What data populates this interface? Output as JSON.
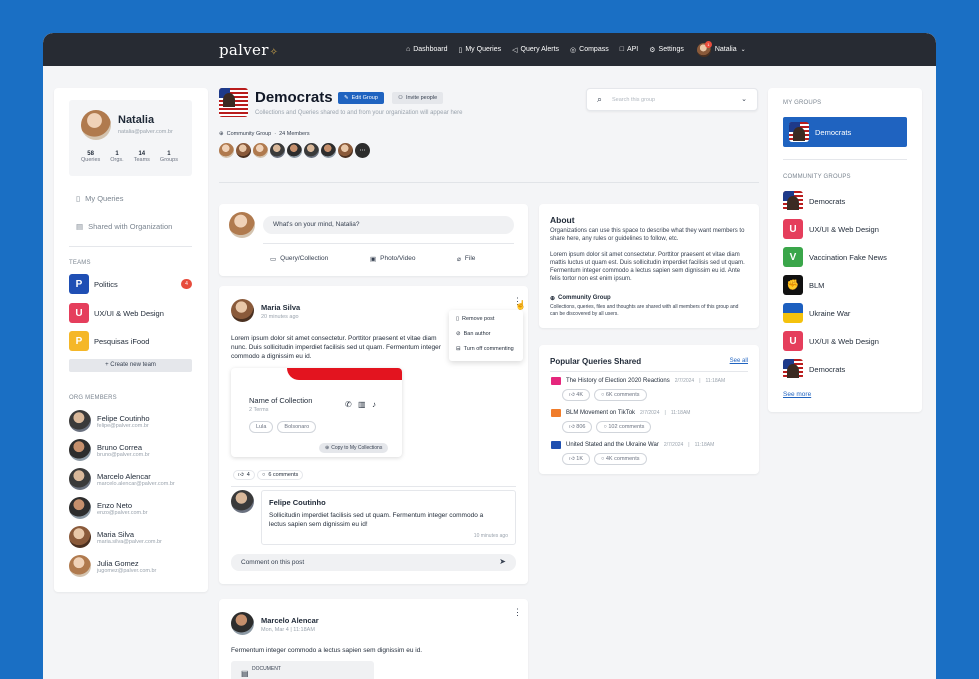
{
  "app": {
    "logo": "palver"
  },
  "nav": {
    "items": [
      {
        "label": "Dashboard",
        "icon": "home-icon"
      },
      {
        "label": "My Queries",
        "icon": "bookmark-icon"
      },
      {
        "label": "Query Alerts",
        "icon": "megaphone-icon"
      },
      {
        "label": "Compass",
        "icon": "compass-icon"
      },
      {
        "label": "API",
        "icon": "api-icon"
      },
      {
        "label": "Settings",
        "icon": "gear-icon"
      }
    ],
    "user": "Natalia",
    "user_badge": "1"
  },
  "profile": {
    "name": "Natalia",
    "email": "natalia@palver.com.br",
    "stats": [
      {
        "value": "58",
        "label": "Queries"
      },
      {
        "value": "1",
        "label": "Orgs."
      },
      {
        "value": "14",
        "label": "Teams"
      },
      {
        "value": "1",
        "label": "Groups"
      }
    ]
  },
  "sidebar": {
    "my_queries": "My Queries",
    "shared": "Shared with Organization",
    "teams_title": "TEAMS",
    "teams": [
      {
        "letter": "P",
        "name": "Politics",
        "color": "#1f4fb4",
        "count": "4"
      },
      {
        "letter": "U",
        "name": "UX/UI & Web Design",
        "color": "#e53e5c",
        "count": ""
      },
      {
        "letter": "P",
        "name": "Pesquisas iFood",
        "color": "#f5b728",
        "count": ""
      }
    ],
    "create_team": "+ Create new team",
    "members_title": "ORG MEMBERS",
    "members": [
      {
        "name": "Felipe Coutinho",
        "email": "felipe@palver.com.br"
      },
      {
        "name": "Bruno Correa",
        "email": "bruno@palver.com.br"
      },
      {
        "name": "Marcelo Alencar",
        "email": "marcelo.alencar@palver.com.br"
      },
      {
        "name": "Enzo Neto",
        "email": "enzo@palver.com.br"
      },
      {
        "name": "Maria Silva",
        "email": "maria.silva@palver.com.br"
      },
      {
        "name": "Julia Gomez",
        "email": "jugomez@palver.com.br"
      }
    ]
  },
  "group": {
    "title": "Democrats",
    "edit": "Edit Group",
    "invite": "Invite people",
    "subtitle": "Collections and Queries shared to and from your organization will appear here",
    "type": "Community Group",
    "members": "24 Members",
    "search_placeholder": "Search this group"
  },
  "composer": {
    "placeholder": "What's on your mind, Natalia?",
    "actions": [
      "Query/Collection",
      "Photo/Video",
      "File"
    ]
  },
  "post1": {
    "author": "Maria Silva",
    "time": "20 minutes ago",
    "body": "Lorem ipsum dolor sit amet consectetur. Porttitor praesent et vitae diam nunc. Duis sollicitudin imperdiet facilisis sed ut quam. Fermentum integer commodo a dignissim eu id.",
    "menu": [
      "Remove post",
      "Ban author",
      "Turn off commenting"
    ],
    "collection": {
      "title": "Name of Collection",
      "terms": "2 Terms",
      "tags": [
        "Lula",
        "Bolsonaro"
      ],
      "copy": "Copy to My Collections"
    },
    "likes": "4",
    "comments": "6 comments",
    "reply": {
      "author": "Felipe Coutinho",
      "body": "Sollicitudin imperdiet facilisis sed ut quam. Fermentum integer commodo a lectus sapien sem dignissim eu id!",
      "time": "10 minutes ago"
    },
    "comment_placeholder": "Comment on this post"
  },
  "post2": {
    "author": "Marcelo Alencar",
    "time": "Mon, Mar 4 | 11:18AM",
    "body": "Fermentum integer commodo a lectus sapien sem dignissim eu id.",
    "doc": "DOCUMENT"
  },
  "about": {
    "title": "About",
    "p1": "Organizations can use this space to describe what they want members to share here, any rules or guidelines to follow, etc.",
    "p2": "Lorem ipsum dolor sit amet consectetur. Porttitor praesent et vitae diam mattis luctus ut quam est. Duis sollicitudin imperdiet facilisis sed ut quam. Fermentum integer commodo a lectus sapien sem dignissim eu id. Ante felis tortor non est enim ipsum.",
    "cg_title": "Community Group",
    "cg_desc": "Collections, queries, files and thoughts are shared with all members of this group and can be discovered by all users."
  },
  "popular": {
    "title": "Popular Queries Shared",
    "see_all": "See all",
    "items": [
      {
        "title": "The History of Election 2020 Reactions",
        "date": "2/7/2024",
        "time": "11:18AM",
        "likes": "4K",
        "comments": "6K comments",
        "color": "#e5267c"
      },
      {
        "title": "BLM Movement on TikTok",
        "date": "2/7/2024",
        "time": "11:18AM",
        "likes": "806",
        "comments": "102 comments",
        "color": "#f07c2a"
      },
      {
        "title": "United Stated and the Ukraine War",
        "date": "2/7/2024",
        "time": "11:18AM",
        "likes": "1K",
        "comments": "4K comments",
        "color": "#1e4fb0"
      }
    ]
  },
  "groups": {
    "my_title": "MY GROUPS",
    "my": [
      {
        "name": "Democrats"
      }
    ],
    "community_title": "COMMUNITY GROUPS",
    "community": [
      {
        "name": "Democrats",
        "kind": "flag"
      },
      {
        "name": "UX/UI & Web Design",
        "kind": "tile",
        "letter": "U",
        "color": "#e53e5c"
      },
      {
        "name": "Vaccination Fake News",
        "kind": "tile",
        "letter": "V",
        "color": "#3aa64a"
      },
      {
        "name": "BLM",
        "kind": "blm"
      },
      {
        "name": "Ukraine War",
        "kind": "ua"
      },
      {
        "name": "UX/UI & Web Design",
        "kind": "tile",
        "letter": "U",
        "color": "#e53e5c"
      },
      {
        "name": "Democrats",
        "kind": "flag"
      }
    ],
    "see_more": "See more"
  }
}
